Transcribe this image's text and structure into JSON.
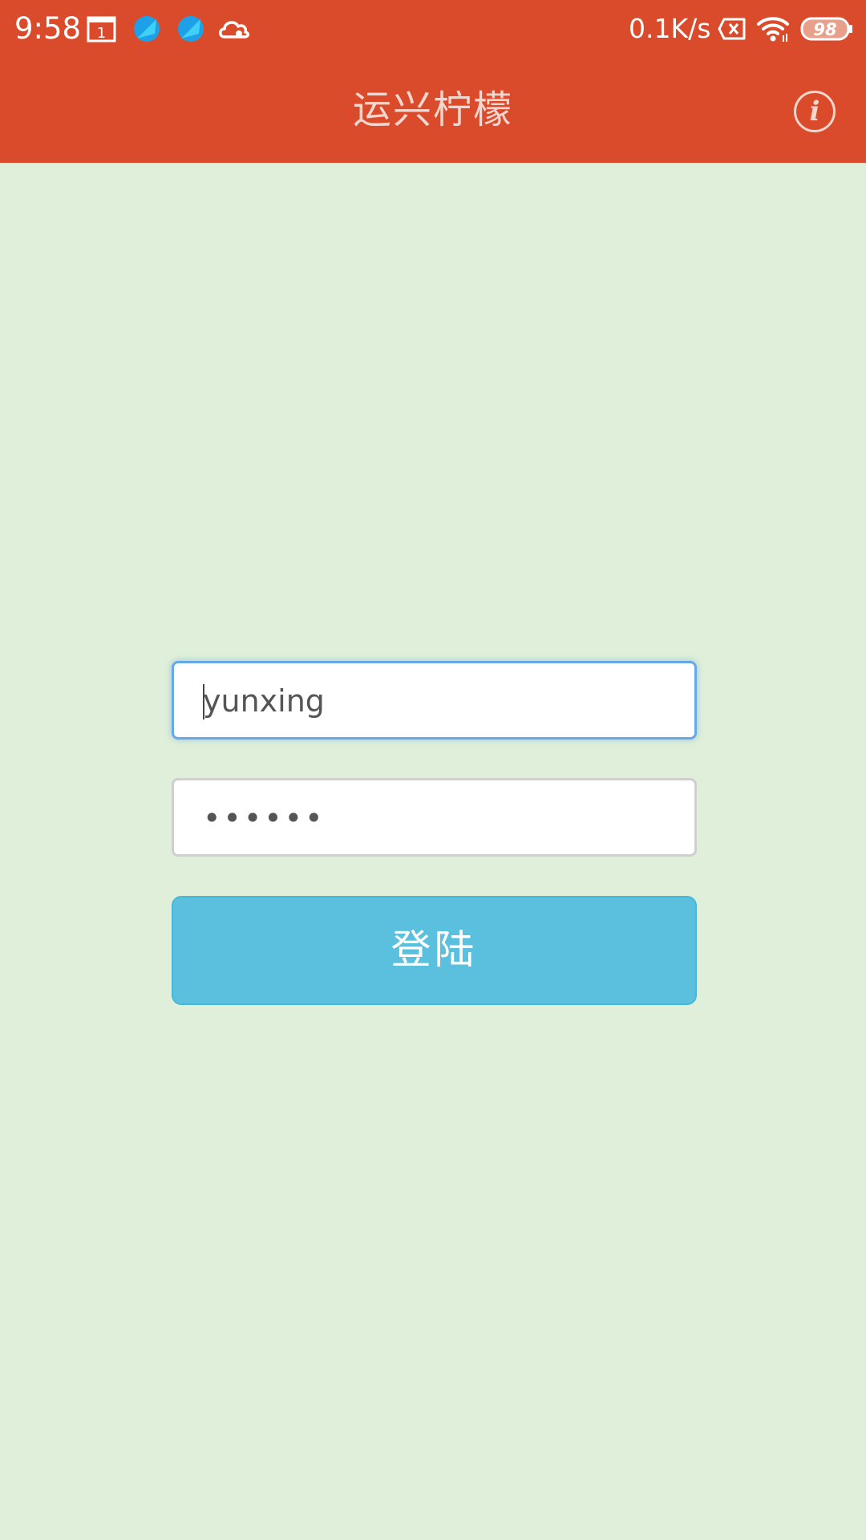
{
  "status_bar": {
    "time": "9:58",
    "calendar_day": "1",
    "net_speed": "0.1K/s",
    "battery": "98",
    "icons": [
      "calendar-icon",
      "browser-icon",
      "browser-icon",
      "cloud-icon",
      "sim-none-icon",
      "wifi-icon",
      "battery-icon"
    ]
  },
  "app_bar": {
    "title": "运兴柠檬",
    "info_icon": "info-icon"
  },
  "login_form": {
    "username_value": "yunxing",
    "password_value": "••••••",
    "login_label": "登陆"
  },
  "colors": {
    "header": "#d94b2b",
    "background": "#dfefd9",
    "button": "#5bc0de",
    "focus_border": "#66a8e8"
  }
}
